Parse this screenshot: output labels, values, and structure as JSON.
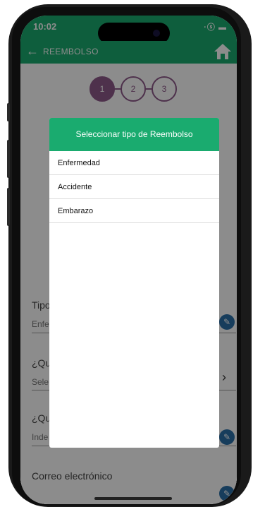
{
  "status_bar": {
    "time": "10:02",
    "icons": "·ⓢ ▬"
  },
  "app_bar": {
    "back_glyph": "←",
    "title": "REEMBOLSO",
    "home_icon": "home-icon"
  },
  "stepper": {
    "steps": [
      "1",
      "2",
      "3"
    ],
    "active_step": 1
  },
  "form": {
    "fields": [
      {
        "label": "Tipo",
        "value": "Enfe"
      },
      {
        "label": "¿Qu",
        "value": "Sele"
      },
      {
        "label": "¿Qu",
        "value": "Inde"
      },
      {
        "label": "Correo electrónico",
        "value": ""
      }
    ]
  },
  "dialog": {
    "title": "Seleccionar tipo de Reembolso",
    "options": [
      "Enfermedad",
      "Accidente",
      "Embarazo"
    ]
  },
  "colors": {
    "brand": "#1aab6f",
    "stepper": "#8e5a8a",
    "edit_button": "#2a6fa8"
  }
}
